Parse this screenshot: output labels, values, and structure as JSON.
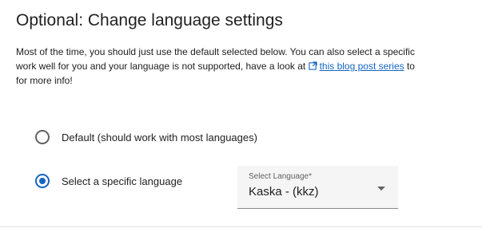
{
  "section": {
    "title": "Optional: Change language settings",
    "description_line1": "Most of the time, you should just use the default selected below. You can also select a specific",
    "description_line2_before": "work well for you and your language is not supported, have a look at ",
    "link_text": "this blog post series",
    "description_line2_after": " to",
    "description_line3": "for more info!"
  },
  "options": [
    {
      "label": "Default (should work with most languages)",
      "selected": false
    },
    {
      "label": "Select a specific language",
      "selected": true
    }
  ],
  "language_select": {
    "label": "Select Language*",
    "value": "Kaska - (kkz)"
  },
  "icons": {
    "link": "external-link-icon",
    "dropdown": "dropdown-arrow-icon"
  },
  "colors": {
    "accent": "#1565c0",
    "text": "#212121",
    "select_bg": "#f5f5f5"
  }
}
